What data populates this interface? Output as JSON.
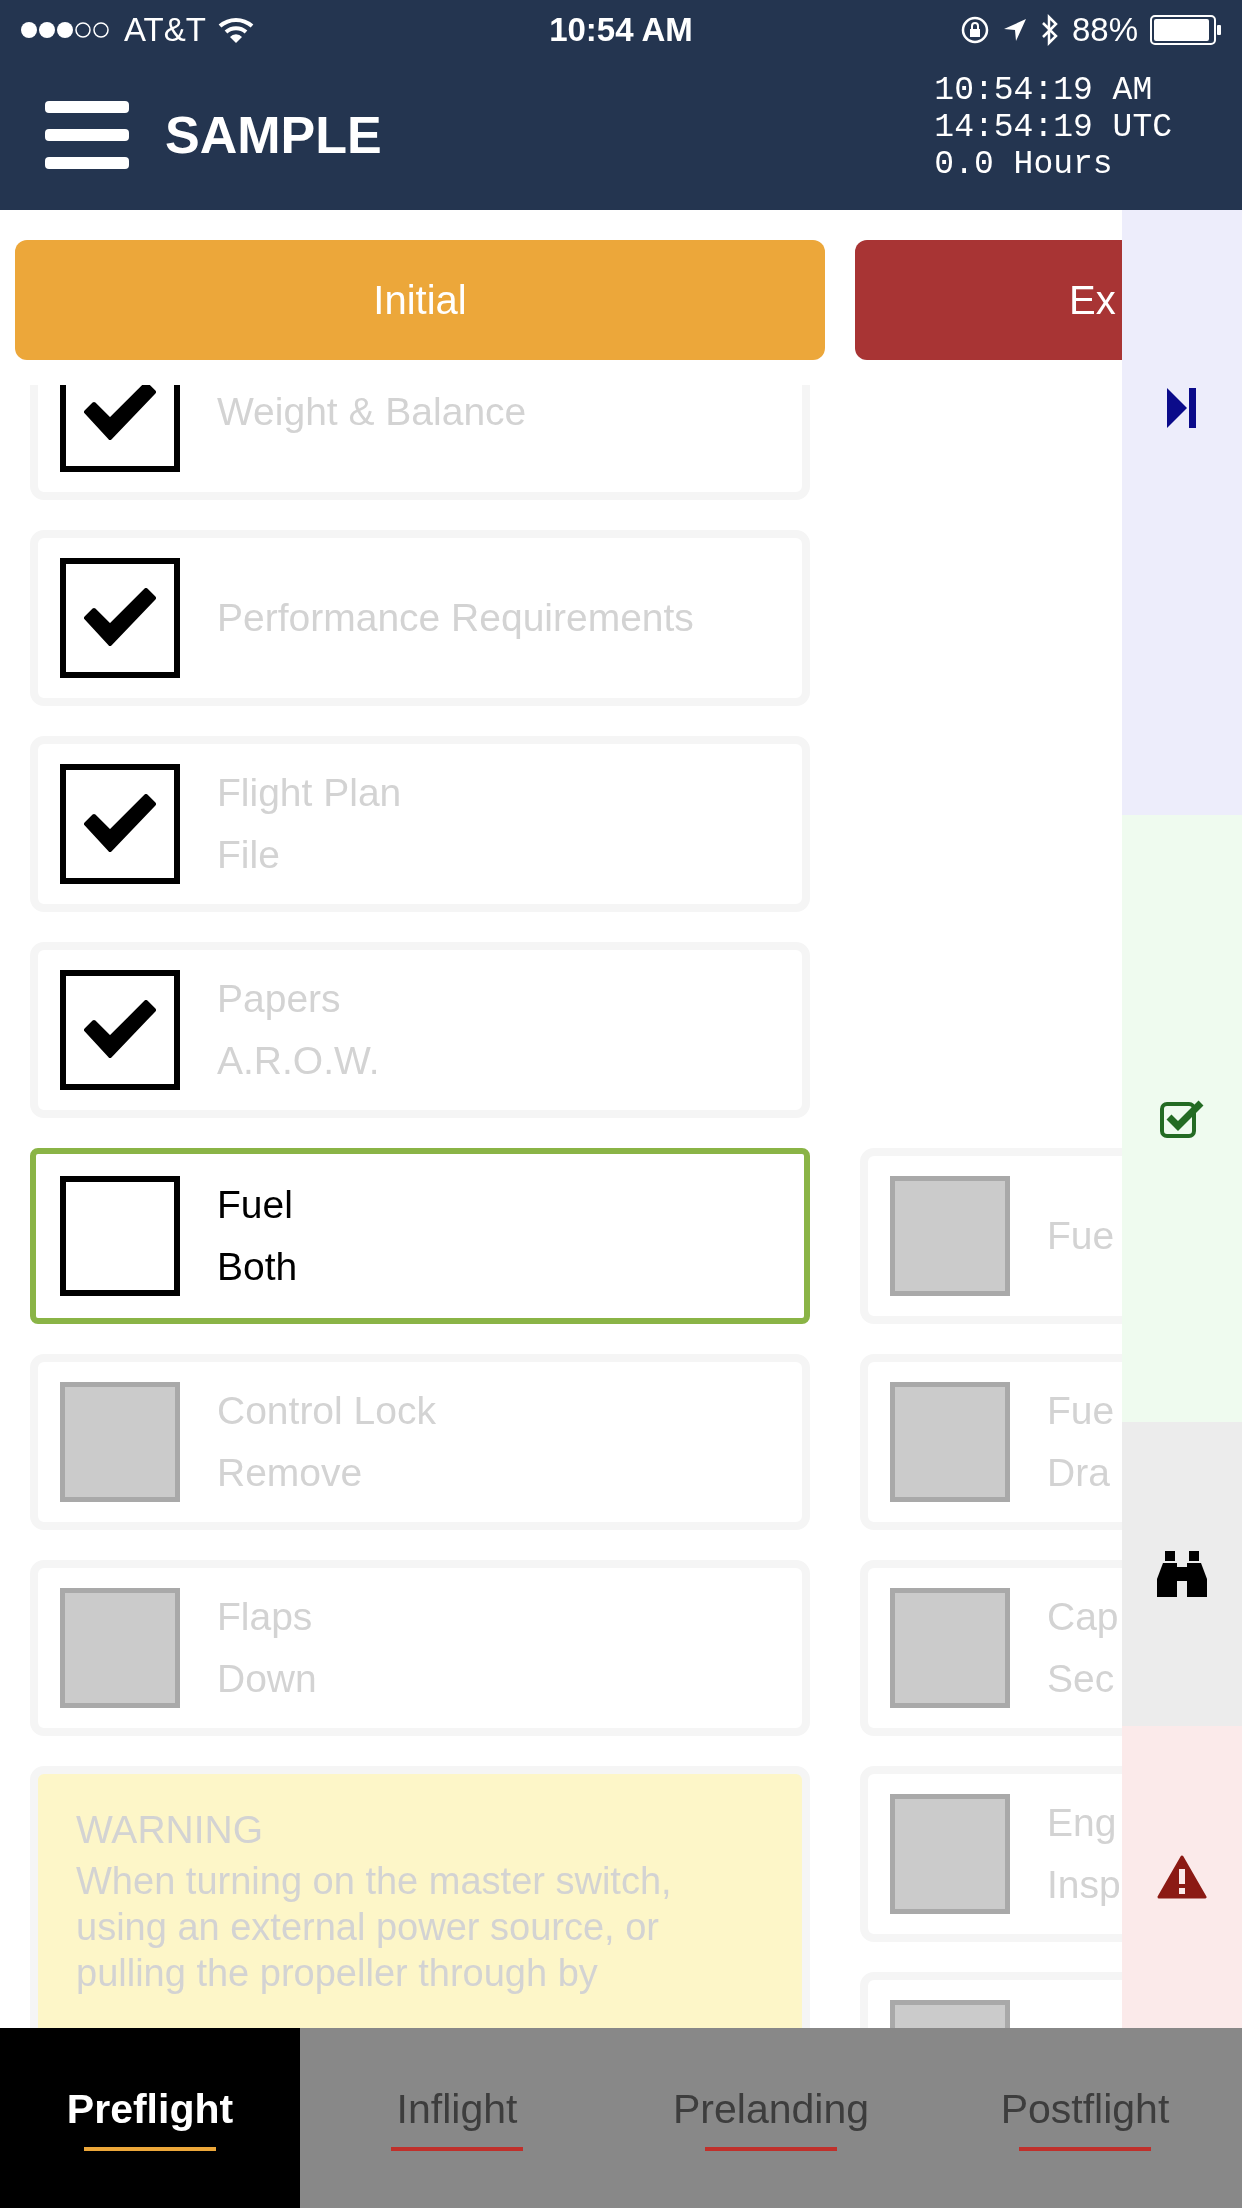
{
  "status_bar": {
    "carrier": "AT&T",
    "time": "10:54 AM",
    "battery": "88%"
  },
  "header": {
    "title": "SAMPLE",
    "clock": [
      "10:54:19 AM",
      "14:54:19 UTC",
      "0.0 Hours"
    ]
  },
  "phases": [
    {
      "label": "Initial",
      "color": "#eca73a"
    },
    {
      "label": "Ex",
      "color": "#a83434"
    }
  ],
  "checklist": {
    "left": [
      {
        "lines": [
          "Weight & Balance"
        ],
        "checked": true,
        "active": false
      },
      {
        "lines": [
          "Performance Requirements"
        ],
        "checked": true,
        "active": false
      },
      {
        "lines": [
          "Flight Plan",
          "File"
        ],
        "checked": true,
        "active": false
      },
      {
        "lines": [
          "Papers",
          "A.R.O.W."
        ],
        "checked": true,
        "active": false
      },
      {
        "lines": [
          "Fuel",
          "Both"
        ],
        "checked": false,
        "active": true
      },
      {
        "lines": [
          "Control Lock",
          "Remove"
        ],
        "checked": false,
        "active": false
      },
      {
        "lines": [
          "Flaps",
          "Down"
        ],
        "checked": false,
        "active": false
      }
    ],
    "right": [
      {
        "lines": [
          "Fue"
        ],
        "checked": false,
        "active": false
      },
      {
        "lines": [
          "Fue",
          "Dra"
        ],
        "checked": false,
        "active": false
      },
      {
        "lines": [
          "Cap",
          "Sec"
        ],
        "checked": false,
        "active": false
      },
      {
        "lines": [
          "Eng",
          "Insp"
        ],
        "checked": false,
        "active": false
      },
      {
        "checked": false,
        "active": false
      }
    ]
  },
  "warning": {
    "title": "WARNING",
    "text": "When turning on the master switch, using an external power source, or pulling the propeller through by"
  },
  "tabs": [
    {
      "label": "Preflight",
      "selected": true
    },
    {
      "label": "Inflight",
      "selected": false
    },
    {
      "label": "Prelanding",
      "selected": false
    },
    {
      "label": "Postflight",
      "selected": false
    }
  ]
}
